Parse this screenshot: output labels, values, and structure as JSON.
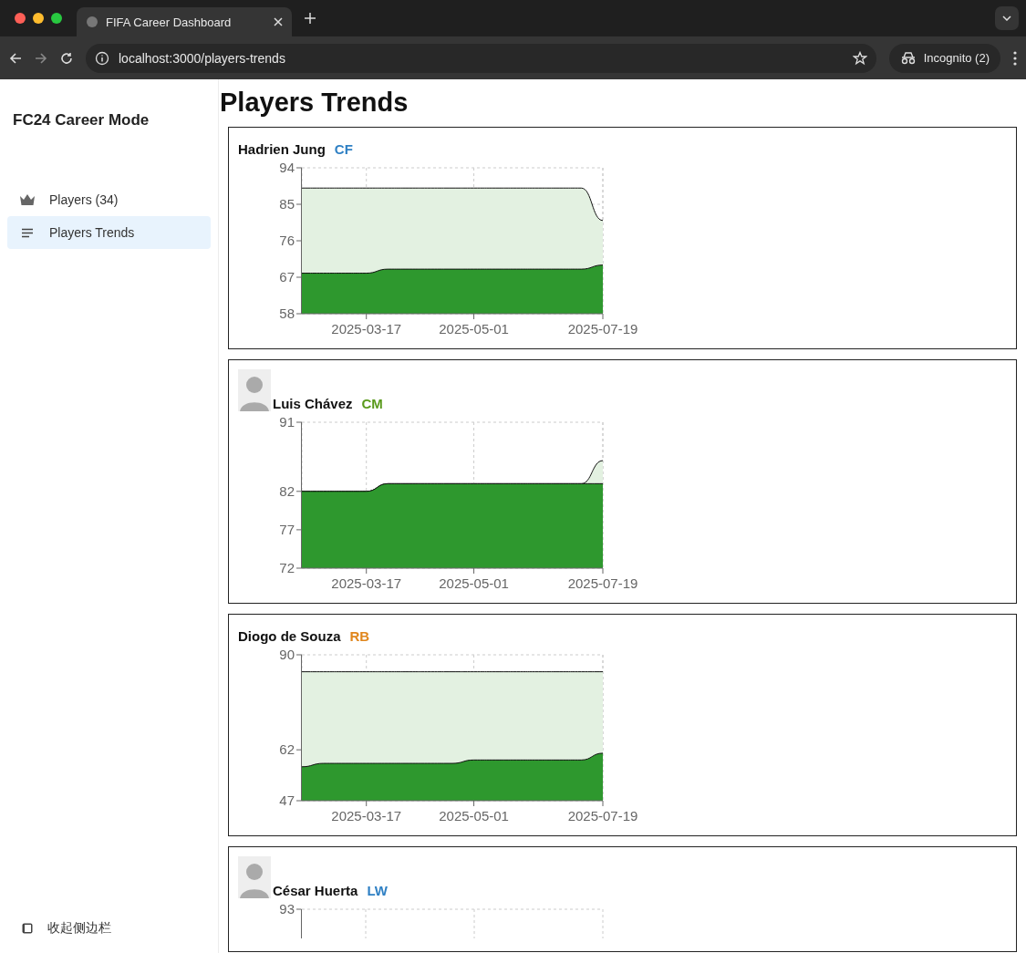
{
  "browser": {
    "tab_title": "FIFA Career Dashboard",
    "url": "localhost:3000/players-trends",
    "profile": "Incognito (2)"
  },
  "sidebar": {
    "title": "FC24 Career Mode",
    "items": [
      {
        "label": "Players (34)",
        "selected": false
      },
      {
        "label": "Players Trends",
        "selected": true
      }
    ],
    "footer": "收起侧边栏"
  },
  "page_title": "Players Trends",
  "players": [
    {
      "name": "Hadrien Jung",
      "position": "CF",
      "color": "#2f80c4",
      "has_photo": false,
      "chart_data": {
        "type": "area",
        "categories": [
          null,
          null,
          null,
          "2025-03-17",
          null,
          null,
          null,
          null,
          "2025-05-01",
          null,
          null,
          null,
          null,
          null,
          "2025-07-19"
        ],
        "grid": true,
        "ylim": [
          58,
          94
        ],
        "yticks": [
          58,
          67,
          76,
          85,
          94
        ],
        "series": [
          {
            "color": "#e3f1e1",
            "values": [
              89,
              89,
              89,
              89,
              89,
              89,
              89,
              89,
              89,
              89,
              89,
              89,
              89,
              89,
              81
            ]
          },
          {
            "color": "#2e982e",
            "values": [
              68,
              68,
              68,
              68,
              69,
              69,
              69,
              69,
              69,
              69,
              69,
              69,
              69,
              69,
              70
            ]
          }
        ]
      }
    },
    {
      "name": "Luis Chávez",
      "position": "CM",
      "color": "#5a9a1c",
      "has_photo": true,
      "chart_data": {
        "type": "area",
        "categories": [
          null,
          null,
          null,
          "2025-03-17",
          null,
          null,
          null,
          null,
          "2025-05-01",
          null,
          null,
          null,
          null,
          null,
          "2025-07-19"
        ],
        "grid": true,
        "ylim": [
          72,
          91
        ],
        "yticks": [
          72,
          77,
          82,
          91
        ],
        "series": [
          {
            "color": "#e3f1e1",
            "values": [
              82,
              82,
              82,
              82,
              83,
              83,
              83,
              83,
              83,
              83,
              83,
              83,
              83,
              83,
              86
            ]
          },
          {
            "color": "#2e982e",
            "values": [
              82,
              82,
              82,
              82,
              83,
              83,
              83,
              83,
              83,
              83,
              83,
              83,
              83,
              83,
              83
            ]
          }
        ]
      }
    },
    {
      "name": "Diogo de Souza",
      "position": "RB",
      "color": "#e0861c",
      "has_photo": false,
      "chart_data": {
        "type": "area",
        "categories": [
          null,
          null,
          null,
          "2025-03-17",
          null,
          null,
          null,
          null,
          "2025-05-01",
          null,
          null,
          null,
          null,
          null,
          "2025-07-19"
        ],
        "grid": true,
        "ylim": [
          47,
          90
        ],
        "yticks": [
          47,
          62,
          90
        ],
        "series": [
          {
            "color": "#e3f1e1",
            "values": [
              85,
              85,
              85,
              85,
              85,
              85,
              85,
              85,
              85,
              85,
              85,
              85,
              85,
              85,
              85
            ]
          },
          {
            "color": "#2e982e",
            "values": [
              57,
              58,
              58,
              58,
              58,
              58,
              58,
              58,
              59,
              59,
              59,
              59,
              59,
              59,
              61
            ]
          }
        ]
      }
    },
    {
      "name": "César Huerta",
      "position": "LW",
      "color": "#2f80c4",
      "has_photo": true,
      "chart_top_label": "93"
    }
  ]
}
